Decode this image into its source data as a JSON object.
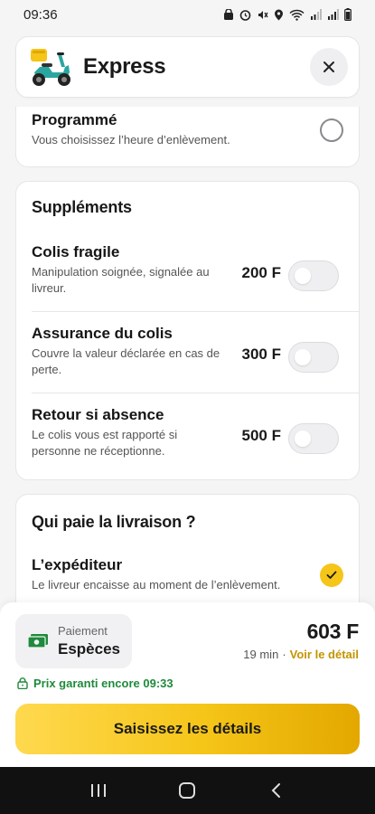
{
  "status_bar": {
    "time": "09:36"
  },
  "header": {
    "title": "Express",
    "close_icon": "close-icon"
  },
  "schedule_option": {
    "title": "Programmé",
    "description": "Vous choisissez l’heure d’enlèvement.",
    "selected": false
  },
  "supplements": {
    "title": "Suppléments",
    "items": [
      {
        "title": "Colis fragile",
        "description": "Manipulation soignée, signalée au livreur.",
        "price": "200 F",
        "enabled": false
      },
      {
        "title": "Assurance du colis",
        "description": "Couvre la valeur déclarée en cas de perte.",
        "price": "300 F",
        "enabled": false
      },
      {
        "title": "Retour si absence",
        "description": "Le colis vous est rapporté si personne ne réceptionne.",
        "price": "500 F",
        "enabled": false
      }
    ]
  },
  "payer": {
    "title": "Qui paie la livraison ?",
    "option_title": "L’expéditeur",
    "option_description": "Le livreur encaisse au moment de l’enlèvement.",
    "selected": true
  },
  "summary": {
    "payment_label": "Paiement",
    "payment_value": "Espèces",
    "total": "603 F",
    "duration": "19 min",
    "separator": "·",
    "detail_link": "Voir le détail",
    "guarantee": "Prix garanti encore 09:33",
    "cta_label": "Saisissez les détails"
  },
  "colors": {
    "accent": "#f5c518",
    "link": "#c39400",
    "guarantee": "#1f8a3b"
  }
}
